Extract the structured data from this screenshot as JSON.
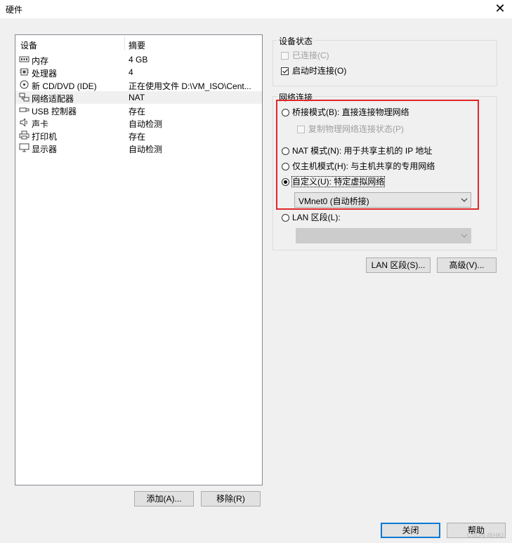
{
  "window": {
    "title": "硬件",
    "close_glyph": "✕"
  },
  "device_list": {
    "columns": {
      "device": "设备",
      "summary": "摘要"
    },
    "rows": [
      {
        "icon": "memory-icon",
        "name": "内存",
        "summary": "4 GB"
      },
      {
        "icon": "processor-icon",
        "name": "处理器",
        "summary": "4"
      },
      {
        "icon": "cd-dvd-icon",
        "name": "新 CD/DVD (IDE)",
        "summary": "正在使用文件 D:\\VM_ISO\\Cent..."
      },
      {
        "icon": "network-adapter-icon",
        "name": "网络适配器",
        "summary": "NAT",
        "selected": true
      },
      {
        "icon": "usb-icon",
        "name": "USB 控制器",
        "summary": "存在"
      },
      {
        "icon": "sound-card-icon",
        "name": "声卡",
        "summary": "自动检测"
      },
      {
        "icon": "printer-icon",
        "name": "打印机",
        "summary": "存在"
      },
      {
        "icon": "display-icon",
        "name": "显示器",
        "summary": "自动检测"
      }
    ]
  },
  "buttons": {
    "add": "添加(A)...",
    "remove": "移除(R)",
    "lan_segments": "LAN 区段(S)...",
    "advanced": "高级(V)...",
    "close": "关闭",
    "help": "帮助"
  },
  "device_status": {
    "title": "设备状态",
    "connected": {
      "label": "已连接(C)",
      "checked": false,
      "enabled": false
    },
    "connect_at_power_on": {
      "label": "启动时连接(O)",
      "checked": true,
      "enabled": true
    }
  },
  "network_connection": {
    "title": "网络连接",
    "bridged": {
      "label": "桥接模式(B): 直接连接物理网络",
      "selected": false
    },
    "replicate_state": {
      "label": "复制物理网络连接状态(P)",
      "checked": false,
      "enabled": false
    },
    "nat": {
      "label": "NAT 模式(N): 用于共享主机的 IP 地址",
      "selected": false
    },
    "host_only": {
      "label": "仅主机模式(H): 与主机共享的专用网络",
      "selected": false
    },
    "custom": {
      "label": "自定义(U): 特定虚拟网络",
      "selected": true
    },
    "custom_select_value": "VMnet0 (自动桥接)",
    "lan_segment": {
      "label": "LAN 区段(L):",
      "selected": false
    },
    "lan_select_value": ""
  },
  "watermark": "CSDN @HKI",
  "colors": {
    "highlight_box": "#e0262a",
    "default_button_border": "#0078d7",
    "window_bg": "#f0f0f0"
  }
}
